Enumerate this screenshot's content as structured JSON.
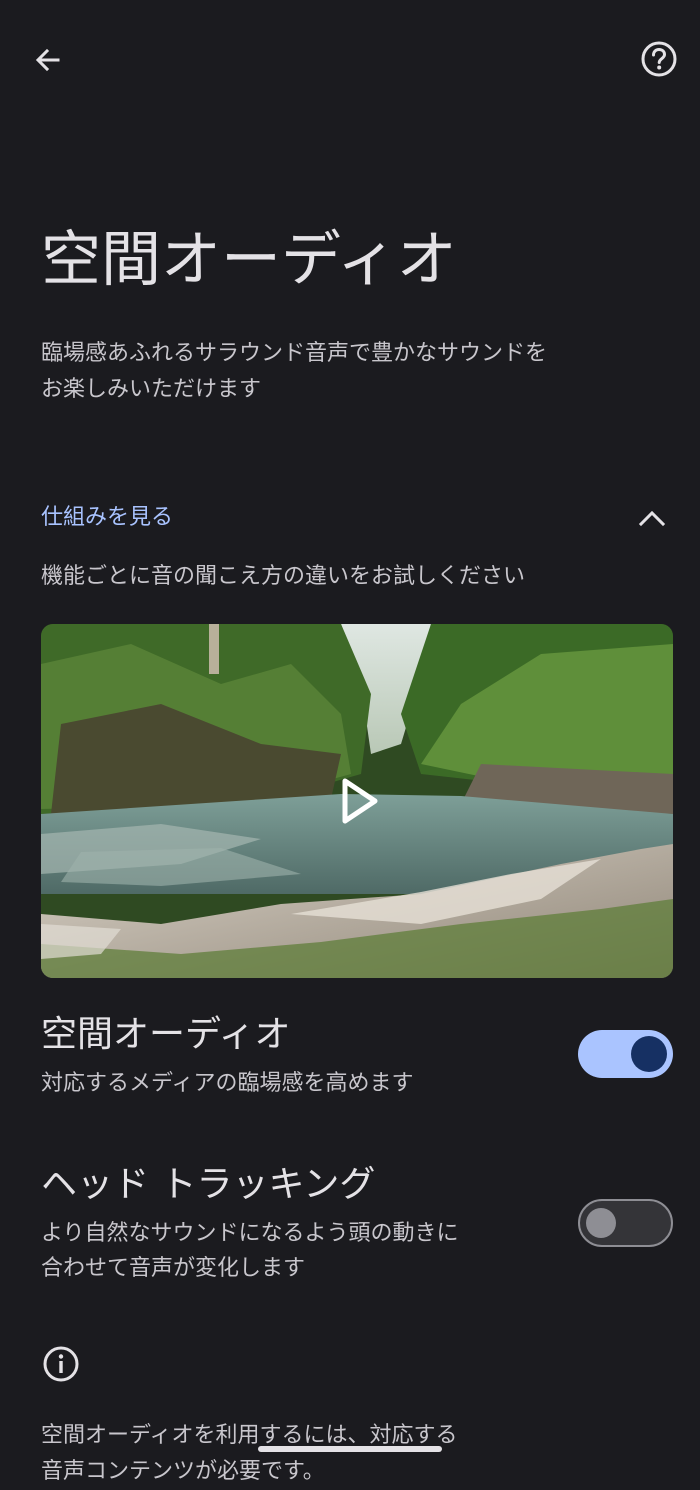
{
  "header": {
    "back_icon": "arrow-back-icon",
    "help_icon": "help-circle-icon"
  },
  "page": {
    "title": "空間オーディオ",
    "description_lines": [
      "臨場感あふれるサラウンド音声で豊かなサウンドを",
      "お楽しみいただけます"
    ]
  },
  "how_it_works": {
    "label": "仕組みを見る",
    "expanded_icon": "chevron-up-icon",
    "subtitle": "機能ごとに音の聞こえ方の違いをお試しください",
    "video_icon": "play-icon"
  },
  "settings": {
    "spatial_audio": {
      "title": "空間オーディオ",
      "description_lines": [
        "対応するメディアの臨場感を高めます"
      ],
      "enabled": true
    },
    "head_tracking": {
      "title": "ヘッド トラッキング",
      "description_lines": [
        "より自然なサウンドになるよう頭の動きに",
        "合わせて音声が変化します"
      ],
      "enabled": false
    }
  },
  "footer": {
    "info_icon": "info-icon",
    "lines": [
      "空間オーディオを利用するには、対応する",
      "音声コンテンツが必要です。"
    ]
  },
  "colors": {
    "background": "#1b1b1f",
    "accent": "#a9c3ff",
    "toggle_on_track": "#aac4ff",
    "toggle_on_knob": "#163063"
  }
}
